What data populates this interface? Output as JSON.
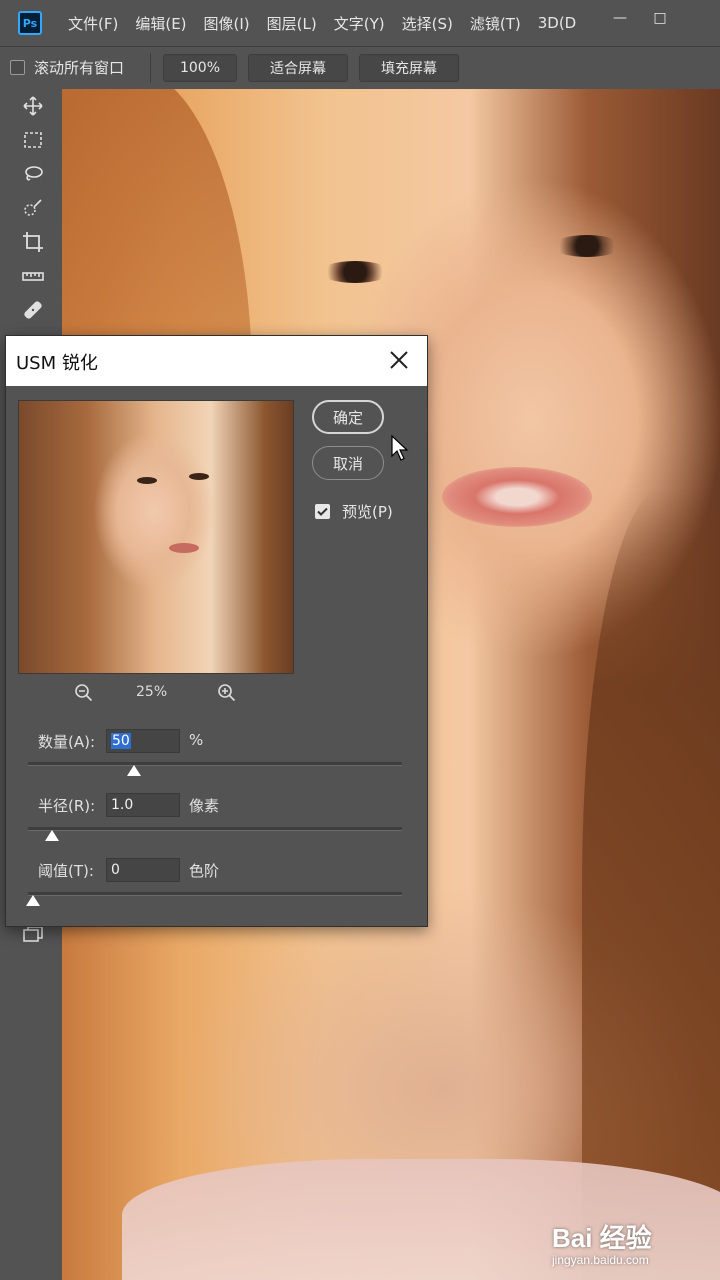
{
  "app": {
    "logo_text": "Ps"
  },
  "menu": {
    "items": [
      "文件(F)",
      "编辑(E)",
      "图像(I)",
      "图层(L)",
      "文字(Y)",
      "选择(S)",
      "滤镜(T)",
      "3D(D"
    ]
  },
  "window_controls": {
    "minimize": "—",
    "maximize": "□"
  },
  "options_bar": {
    "scroll_all_windows_label": "滚动所有窗口",
    "scroll_all_windows_checked": false,
    "zoom_button": "100%",
    "fit_screen_button": "适合屏幕",
    "fill_screen_button": "填充屏幕"
  },
  "toolbar": {
    "tools": [
      "move-tool",
      "marquee-tool",
      "lasso-tool",
      "quick-selection-tool",
      "crop-tool",
      "ruler-tool",
      "healing-brush-tool",
      "screen-mode-tool"
    ]
  },
  "dialog": {
    "title": "USM 锐化",
    "ok_button": "确定",
    "cancel_button": "取消",
    "preview_label": "预览(P)",
    "preview_checked": true,
    "zoom_level": "25%",
    "amount": {
      "label": "数量(A):",
      "value": "50",
      "unit": "%",
      "slider_fraction": 0.27
    },
    "radius": {
      "label": "半径(R):",
      "value": "1.0",
      "unit": "像素",
      "slider_fraction": 0.05
    },
    "threshold": {
      "label": "阈值(T):",
      "value": "0",
      "unit": "色阶",
      "slider_fraction": 0.0
    }
  },
  "watermark": {
    "main": "Bai 经验",
    "sub": "jingyan.baidu.com"
  },
  "colors": {
    "ui_bg": "#535353",
    "accent_selection": "#2f6fcf",
    "ps_blue": "#31a8ff"
  }
}
